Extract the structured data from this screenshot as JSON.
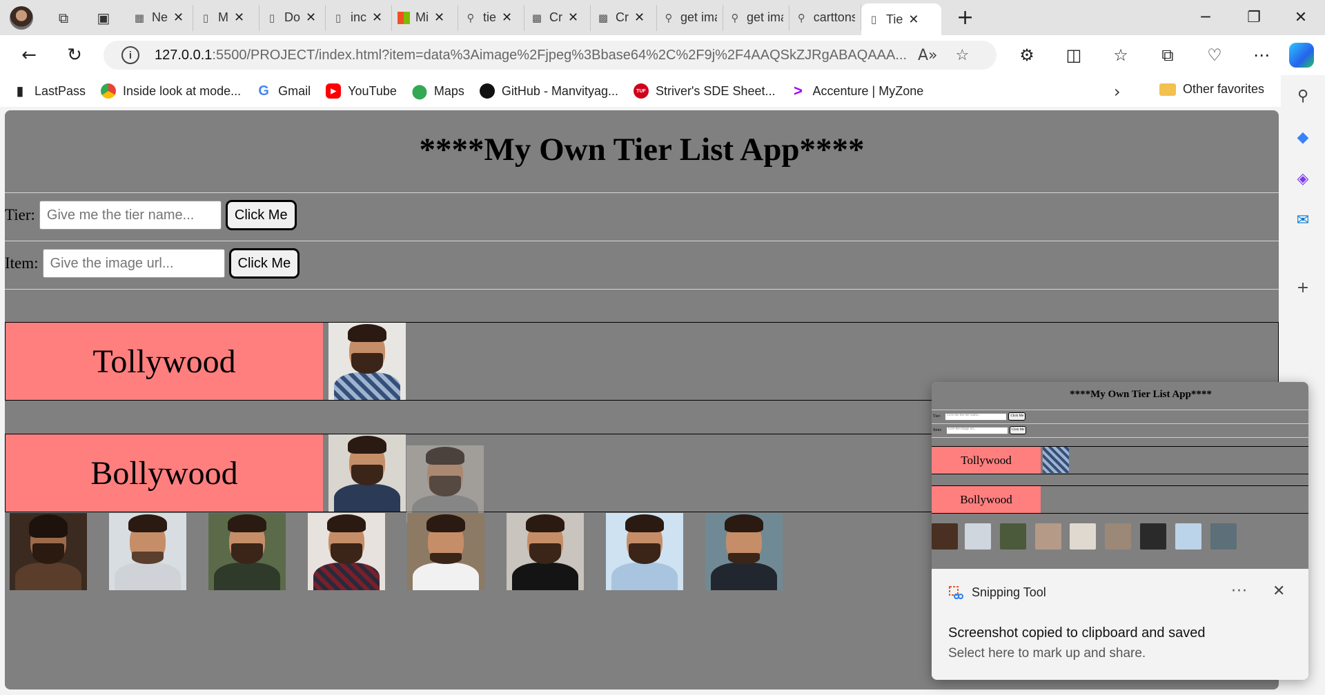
{
  "browser": {
    "tabs": [
      {
        "icon": "calendar-icon",
        "label": "Ne"
      },
      {
        "icon": "page-icon",
        "label": "M"
      },
      {
        "icon": "page-icon",
        "label": "Do"
      },
      {
        "icon": "page-icon",
        "label": "inc"
      },
      {
        "icon": "microsoft-icon",
        "label": "Mi"
      },
      {
        "icon": "search-icon",
        "label": "tie"
      },
      {
        "icon": "image-icon",
        "label": "Cr"
      },
      {
        "icon": "image-icon",
        "label": "Cr"
      },
      {
        "icon": "search-icon",
        "label": "get ima"
      },
      {
        "icon": "search-icon",
        "label": "get ima"
      },
      {
        "icon": "search-icon",
        "label": "carttons"
      },
      {
        "icon": "page-icon",
        "label": "Tie",
        "active": true
      }
    ],
    "url_host": "127.0.0.1",
    "url_rest": ":5500/PROJECT/index.html?item=data%3Aimage%2Fjpeg%3Bbase64%2C%2F9j%2F4AAQSkZJRgABAQAAA...",
    "bookmarks": [
      {
        "icon": "lastpass-icon",
        "label": "LastPass",
        "color": "#222222"
      },
      {
        "icon": "chrome-icon",
        "label": "Inside look at mode...",
        "color": "#ea4335"
      },
      {
        "icon": "google-icon",
        "label": "Gmail",
        "color": "#4285f4"
      },
      {
        "icon": "youtube-icon",
        "label": "YouTube",
        "color": "#ff0000"
      },
      {
        "icon": "maps-icon",
        "label": "Maps",
        "color": "#34a853"
      },
      {
        "icon": "github-icon",
        "label": "GitHub - Manvityag...",
        "color": "#111111"
      },
      {
        "icon": "tuf-icon",
        "label": "Striver's SDE Sheet...",
        "color": "#d0021b"
      },
      {
        "icon": "accenture-icon",
        "label": "Accenture | MyZone",
        "color": "#a100ff"
      }
    ],
    "other_favorites": "Other favorites"
  },
  "app": {
    "title": "****My Own Tier List App****",
    "tier_form": {
      "label": "Tier:",
      "placeholder": "Give me the tier name...",
      "button": "Click Me"
    },
    "item_form": {
      "label": "Item:",
      "placeholder": "Give the image url...",
      "button": "Click Me"
    },
    "tiers": [
      {
        "name": "Tollywood"
      },
      {
        "name": "Bollywood"
      }
    ]
  },
  "snipping": {
    "app_name": "Snipping Tool",
    "more": "···",
    "headline": "Screenshot copied to clipboard and saved",
    "subline": "Select here to mark up and share."
  }
}
